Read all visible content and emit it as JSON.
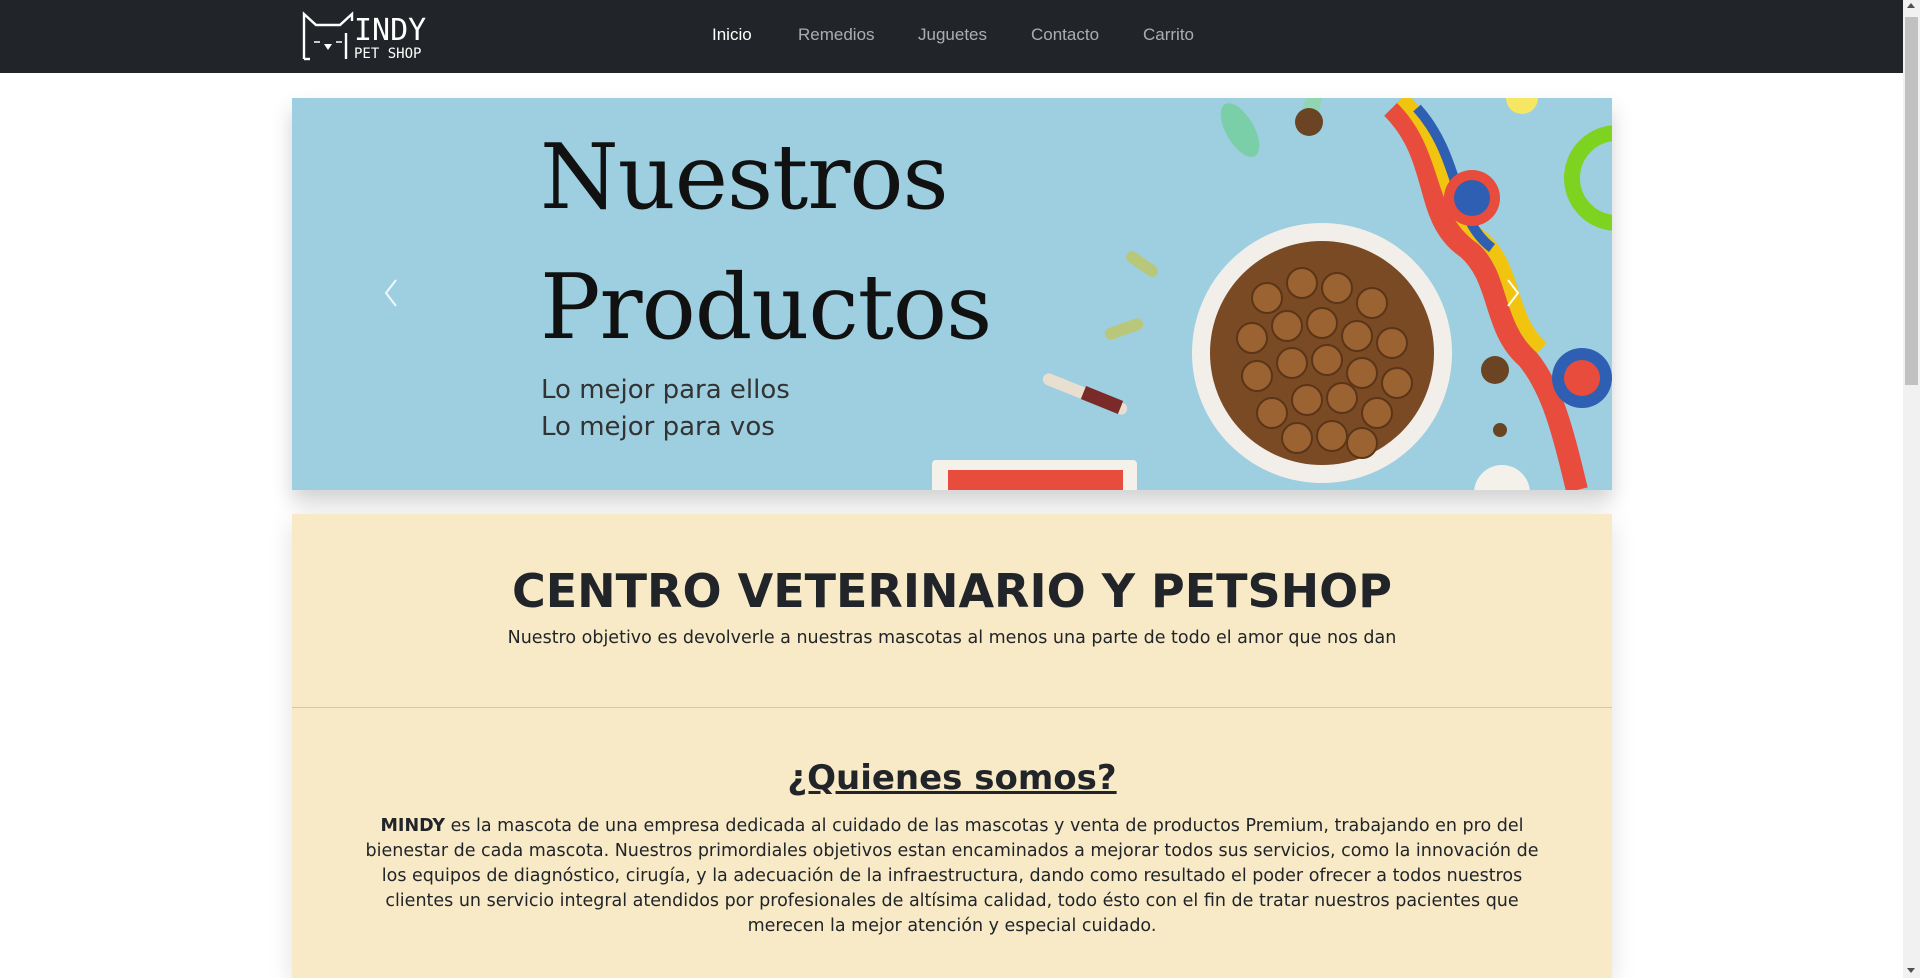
{
  "brand": {
    "name": "INDY",
    "logo_letter": "M",
    "subtitle": "PET SHOP"
  },
  "nav": {
    "items": [
      {
        "label": "Inicio",
        "active": true
      },
      {
        "label": "Remedios",
        "active": false
      },
      {
        "label": "Juguetes",
        "active": false
      },
      {
        "label": "Contacto",
        "active": false
      },
      {
        "label": "Carrito",
        "active": false
      }
    ]
  },
  "carousel": {
    "title_line1": "Nuestros",
    "title_line2": "Productos",
    "subtitle_line1": "Lo mejor para ellos",
    "subtitle_line2": "Lo mejor para vos"
  },
  "hero": {
    "heading": "CENTRO VETERINARIO Y PETSHOP",
    "subheading": "Nuestro objetivo es devolverle a nuestras mascotas al menos una parte de todo el amor que nos dan"
  },
  "about": {
    "heading": "¿Quienes somos?",
    "brand_bold": "MINDY",
    "text": " es la mascota de una empresa dedicada al cuidado de las mascotas y venta de productos Premium, trabajando en pro del bienestar de cada mascota. Nuestros primordiales objetivos estan encaminados a mejorar todos sus servicios, como la innovación de los equipos de diagnóstico, cirugía, y la adecuación de la infraestructura, dando como resultado el poder ofrecer a todos nuestros clientes un servicio integral atendidos por profesionales de altísima calidad, todo ésto con el fin de tratar nuestros pacientes que merecen la mejor atención y especial cuidado."
  },
  "colors": {
    "navbar": "#212529",
    "carousel_bg": "#9dcfe0",
    "content_bg": "#f8e9c7",
    "text": "#212529"
  }
}
